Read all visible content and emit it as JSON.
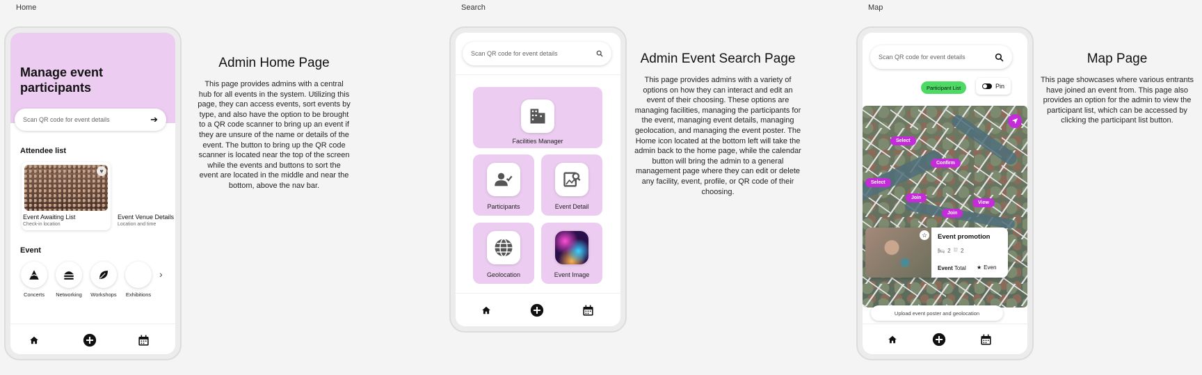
{
  "frames": {
    "home_label": "Home",
    "search_label": "Search",
    "map_label": "Map"
  },
  "home": {
    "title": "Manage event participants",
    "qr_placeholder": "Scan QR code for event details",
    "attendee_title": "Attendee list",
    "cards": [
      {
        "title": "Event Awaiting List",
        "subtitle": "Check-in location"
      },
      {
        "title": "Event Venue Details",
        "subtitle": "Location and time"
      }
    ],
    "event_title": "Event",
    "categories": [
      "Concerts",
      "Networking",
      "Workshops",
      "Exhibitions"
    ]
  },
  "home_desc": {
    "title": "Admin Home Page",
    "text": "This page provides admins with a central hub for all events in the system. Utilizing this page, they can access events, sort events by type, and also have the option to be brought to a QR code scanner to bring up an event if they are unsure of the name or details of the event. The button to bring up the QR code scanner is located near the top of the screen while the events and buttons to sort the event are located in the middle and near the bottom, above the nav bar."
  },
  "search": {
    "qr_placeholder": "Scan QR code for event details",
    "tiles": [
      "Facilities Manager",
      "Participants",
      "Event Detail",
      "Geolocation",
      "Event Image"
    ]
  },
  "search_desc": {
    "title": "Admin Event Search Page",
    "text": "This page provides admins with a variety of options on how they can interact and edit an event of their choosing. These options are managing facilities, managing the participants for the event, managing event details, managing geolocation, and managing the event poster. The Home icon located at the bottom left will take the admin back to the home page, while the calendar button will bring the admin to a general management page where they can edit or delete any facility, event, profile, or QR code of their choosing."
  },
  "map": {
    "qr_placeholder": "Scan QR code for event details",
    "participant_list": "Participant List",
    "pin": "Pin",
    "tags": [
      "Select",
      "Confirm",
      "Select",
      "Join",
      "View",
      "Join"
    ],
    "event_title": "Event promotion",
    "stat1": "2",
    "stat2": "2",
    "event_total": "Event",
    "event_total_suffix": "Total",
    "even": "Even",
    "upload": "Upload event poster and geolocation"
  },
  "map_desc": {
    "title": "Map Page",
    "text": "This page showcases where various entrants have joined an event from. This page also provides an option for the admin to view the participant list, which can be accessed by clicking the participant list button."
  },
  "colors": {
    "accent_pink": "#eccdf1",
    "tag_magenta": "#c42bd9",
    "pill_green": "#4cd964"
  }
}
